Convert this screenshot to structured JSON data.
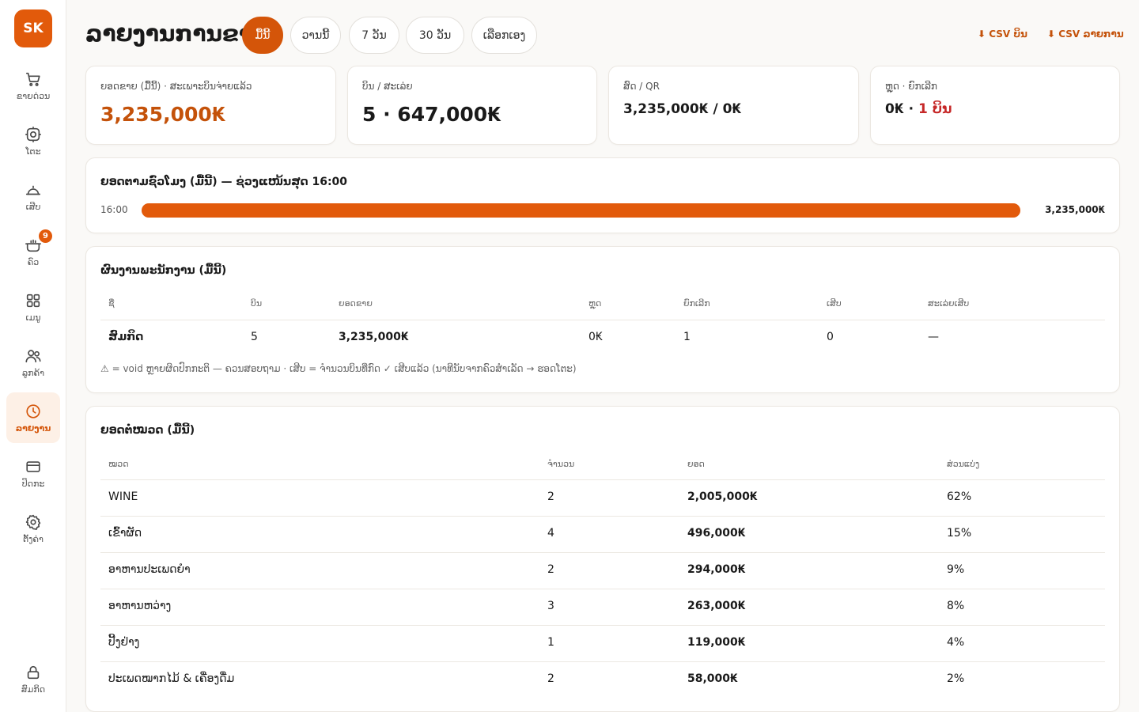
{
  "app": {
    "logo": "SK"
  },
  "sidebar": {
    "items": [
      {
        "label": "ຂາຍດ່ວນ",
        "icon": "cart-icon"
      },
      {
        "label": "ໂຕະ",
        "icon": "table-icon"
      },
      {
        "label": "ເສີບ",
        "icon": "serving-cloche-icon"
      },
      {
        "label": "ຄົວ",
        "icon": "pot-icon",
        "badge": "9"
      },
      {
        "label": "ເມນູ",
        "icon": "grid-icon"
      },
      {
        "label": "ລູກຄ້າ",
        "icon": "users-icon"
      },
      {
        "label": "ລາຍງານ",
        "icon": "clock-icon",
        "active": true
      },
      {
        "label": "ປິດກະ",
        "icon": "card-icon"
      },
      {
        "label": "ຕັ້ງຄ່າ",
        "icon": "gear-icon"
      }
    ],
    "user": {
      "label": "ສົມກິດ",
      "icon": "lock-icon"
    }
  },
  "header": {
    "title": "ລາຍງານການຂາຍ",
    "ranges": [
      "ມື້ນີ້",
      "ວານນີ້",
      "7 ວັນ",
      "30 ວັນ",
      "ເລືອກເອງ"
    ],
    "active_range": "ມື້ນີ້",
    "csv_bills": "⬇ CSV ບິນ",
    "csv_items": "⬇ CSV ລາຍການ"
  },
  "stats": [
    {
      "label": "ຍອດຂາຍ (ມື້ນີ້) · ສະເພາະບິນຈ່າຍແລ້ວ",
      "value": "3,235,000₭"
    },
    {
      "label": "ບິນ / ສະເລ່ຍ",
      "value": "5 · 647,000₭"
    },
    {
      "label": "ສົດ / QR",
      "value": "3,235,000₭ / 0₭"
    },
    {
      "label": "ຫຼຸດ · ຍົກເລີກ",
      "value_a": "0₭ · ",
      "value_b": "1 ບິນ"
    }
  ],
  "hourly": {
    "title": "ຍອດຕາມຊົ່ວໂມງ (ມື້ນີ້) — ຊ່ວງແໜ້ນສຸດ 16:00",
    "rows": [
      {
        "hour": "16:00",
        "value": "3,235,000₭",
        "fraction": 1.0
      }
    ]
  },
  "staff": {
    "title": "ຜົນງານພະນັກງານ (ມື້ນີ້)",
    "columns": [
      "ຊື່",
      "ບິນ",
      "ຍອດຂາຍ",
      "ຫຼຸດ",
      "ຍົກເລີກ",
      "ເສີບ",
      "ສະເລ່ຍເສີບ"
    ],
    "rows": [
      [
        "ສົມກິດ",
        "5",
        "3,235,000₭",
        "0₭",
        "1",
        "0",
        "—"
      ]
    ],
    "note": "⚠ = void ຫຼາຍຜິດປົກກະຕິ — ຄວນສອບຖາມ · ເສີບ = ຈຳນວນບິນທີ່ກົດ ✓ ເສີບແລ້ວ (ນາທີນັບຈາກຄົວສຳເລັດ → ຮອດໂຕະ)"
  },
  "category": {
    "title": "ຍອດຕໍ່ໝວດ (ມື້ນີ້)",
    "columns": [
      "ໝວດ",
      "ຈຳນວນ",
      "ຍອດ",
      "ສ່ວນແບ່ງ"
    ],
    "rows": [
      [
        "WINE",
        "2",
        "2,005,000₭",
        "62%"
      ],
      [
        "ເຂົ້າຜັດ",
        "4",
        "496,000₭",
        "15%"
      ],
      [
        "ອາຫານປະເພດຍຳ",
        "2",
        "294,000₭",
        "9%"
      ],
      [
        "ອາຫານຫວ່າງ",
        "3",
        "263,000₭",
        "8%"
      ],
      [
        "ປີ້ງຢ່າງ",
        "1",
        "119,000₭",
        "4%"
      ],
      [
        "ປະເພດໝາກໄມ້ & ເຄື່ອງດື່ມ",
        "2",
        "58,000₭",
        "2%"
      ]
    ]
  },
  "colors": {
    "accent": "#e25a0b",
    "accent_dark": "#c4520a",
    "danger": "#c62828"
  }
}
